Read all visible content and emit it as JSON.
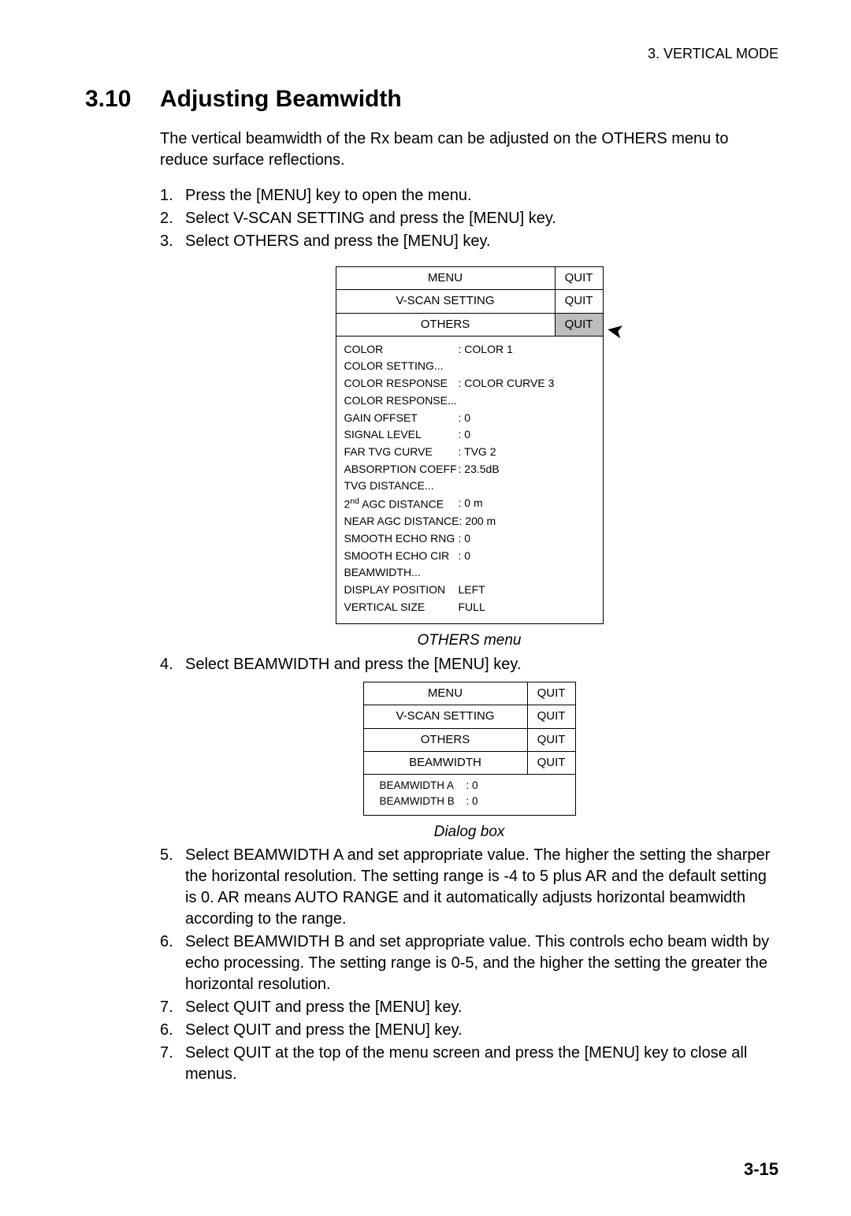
{
  "header": "3.  VERTICAL  MODE",
  "section_number": "3.10",
  "section_title": "Adjusting Beamwidth",
  "intro": "The vertical beamwidth of the Rx beam can be adjusted on the OTHERS menu to reduce surface reflections.",
  "steps_a": [
    {
      "n": "1.",
      "t": "Press the [MENU] key to open the menu."
    },
    {
      "n": "2.",
      "t": "Select V-SCAN SETTING and press the [MENU] key."
    },
    {
      "n": "3.",
      "t": "Select OTHERS and press the [MENU] key."
    }
  ],
  "menu": {
    "rows": [
      {
        "label": "MENU",
        "quit": "QUIT",
        "hl": false
      },
      {
        "label": "V-SCAN SETTING",
        "quit": "QUIT",
        "hl": false
      },
      {
        "label": "OTHERS",
        "quit": "QUIT",
        "hl": true
      }
    ],
    "items": [
      {
        "k": "COLOR",
        "v": ": COLOR 1"
      },
      {
        "k": "COLOR SETTING...",
        "v": ""
      },
      {
        "k": "COLOR RESPONSE",
        "v": ": COLOR CURVE 3"
      },
      {
        "k": "COLOR RESPONSE...",
        "v": ""
      },
      {
        "k": "GAIN OFFSET",
        "v": ": 0"
      },
      {
        "k": "SIGNAL LEVEL",
        "v": ": 0"
      },
      {
        "k": "FAR TVG CURVE",
        "v": ": TVG 2"
      },
      {
        "k": "ABSORPTION COEFF",
        "v": ": 23.5dB"
      },
      {
        "k": "TVG DISTANCE...",
        "v": ""
      },
      {
        "k": "2nd AGC DISTANCE",
        "v": ": 0 m",
        "sup": true
      },
      {
        "k": "NEAR AGC DISTANCE",
        "v": ": 200 m"
      },
      {
        "k": "SMOOTH ECHO RNG",
        "v": ": 0"
      },
      {
        "k": "SMOOTH ECHO CIR",
        "v": ": 0"
      },
      {
        "k": "BEAMWIDTH...",
        "v": ""
      },
      {
        "k": "DISPLAY POSITION",
        "v": "  LEFT"
      },
      {
        "k": "VERTICAL SIZE",
        "v": "  FULL"
      }
    ]
  },
  "caption1": "OTHERS menu",
  "steps_b": [
    {
      "n": "4.",
      "t": "Select BEAMWIDTH and press the [MENU] key."
    }
  ],
  "dialog": {
    "rows": [
      {
        "label": "MENU",
        "quit": "QUIT"
      },
      {
        "label": "V-SCAN SETTING",
        "quit": "QUIT"
      },
      {
        "label": "OTHERS",
        "quit": "QUIT"
      },
      {
        "label": "BEAMWIDTH",
        "quit": "QUIT"
      }
    ],
    "items": [
      {
        "k": "BEAMWIDTH A",
        "v": ": 0"
      },
      {
        "k": "BEAMWIDTH B",
        "v": ": 0"
      }
    ]
  },
  "caption2": "Dialog box",
  "steps_c": [
    {
      "n": "5.",
      "t": "Select BEAMWIDTH A and set appropriate value. The higher the setting the sharper the horizontal resolution. The setting range is -4 to 5 plus AR and the default setting is 0. AR means AUTO RANGE and it automatically adjusts horizontal beamwidth according to the range."
    },
    {
      "n": "6.",
      "t": "Select BEAMWIDTH B and set appropriate value. This controls echo beam width by echo processing. The setting range is 0-5, and the higher the setting the greater the horizontal resolution."
    },
    {
      "n": "7.",
      "t": "Select QUIT and press the [MENU] key."
    },
    {
      "n": "6.",
      "t": "Select QUIT and press the [MENU] key."
    },
    {
      "n": "7.",
      "t": "Select QUIT at the top of the menu screen and press the [MENU] key to close all menus."
    }
  ],
  "pageno": "3-15"
}
